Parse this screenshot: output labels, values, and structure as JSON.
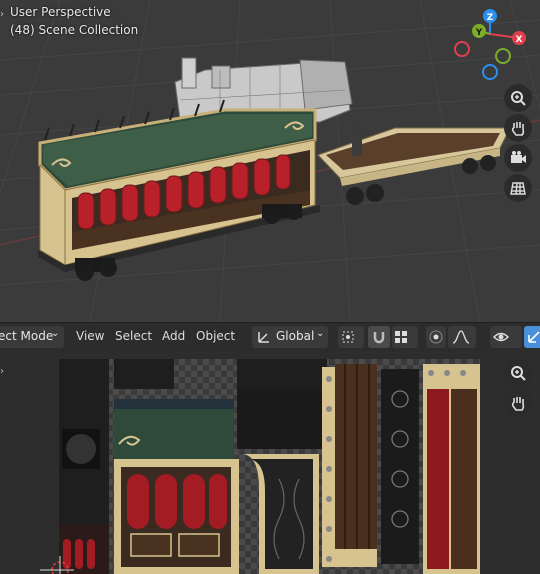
{
  "viewport": {
    "view_name": "User Perspective",
    "collection": "(48) Scene Collection",
    "gizmo": {
      "z": "Z",
      "y": "Y",
      "x": "X"
    },
    "nav_buttons": [
      "zoom-icon",
      "hand-pan-icon",
      "camera-icon",
      "ortho-grid-icon"
    ]
  },
  "header": {
    "mode": "ect Mode",
    "menus": {
      "view": "View",
      "select": "Select",
      "add": "Add",
      "object": "Object"
    },
    "orientation": "Global"
  },
  "uv_editor": {
    "nav_buttons": [
      "zoom-icon",
      "hand-pan-icon"
    ]
  },
  "colors": {
    "gizmo_x": "#e0404e",
    "gizmo_y": "#7dac29",
    "gizmo_z": "#2c8ff0",
    "accent_blue": "#4a90d9"
  }
}
